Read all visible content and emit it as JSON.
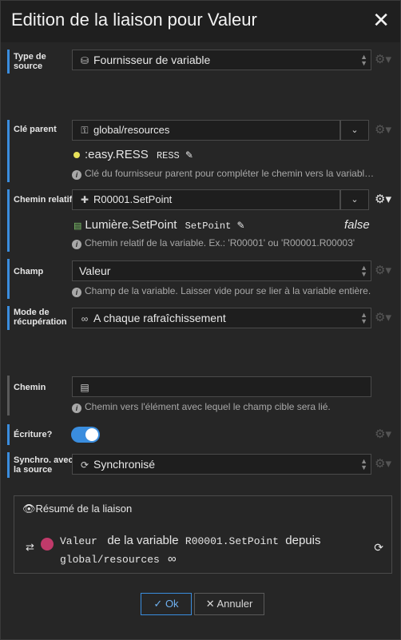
{
  "dialog": {
    "title": "Edition de la liaison pour Valeur",
    "close": "✕"
  },
  "type_source": {
    "label": "Type de source",
    "value": "Fournisseur de variable"
  },
  "cle_parent": {
    "label": "Clé parent",
    "value": "global/resources",
    "resolved_name": ":easy.RESS",
    "resolved_code": "RESS",
    "hint": "Clé du fournisseur parent pour compléter le chemin vers la variabl…"
  },
  "chemin_relatif": {
    "label": "Chemin relatif",
    "value": "R00001.SetPoint",
    "resolved_name": "Lumière.SetPoint",
    "resolved_code": "SetPoint",
    "resolved_value": "false",
    "hint": "Chemin relatif de la variable. Ex.: 'R00001' ou 'R00001.R00003'"
  },
  "champ": {
    "label": "Champ",
    "value": "Valeur",
    "hint": "Champ de la variable. Laisser vide pour se lier à la variable entière."
  },
  "mode": {
    "label": "Mode de récupération",
    "value": "A chaque rafraîchissement"
  },
  "chemin": {
    "label": "Chemin",
    "value": "",
    "hint": "Chemin vers l'élément avec lequel le champ cible sera lié."
  },
  "ecriture": {
    "label": "Écriture?",
    "enabled": true
  },
  "synchro": {
    "label": "Synchro. avec la source",
    "value": "Synchronisé"
  },
  "summary": {
    "title": "Résumé de la liaison",
    "field": "Valeur",
    "text1": "de la variable",
    "variable": "R00001.SetPoint",
    "text2": "depuis",
    "source": "global/resources"
  },
  "buttons": {
    "ok": "Ok",
    "cancel": "Annuler"
  },
  "colors": {
    "accent": "#3a8dde",
    "background": "#262626"
  }
}
